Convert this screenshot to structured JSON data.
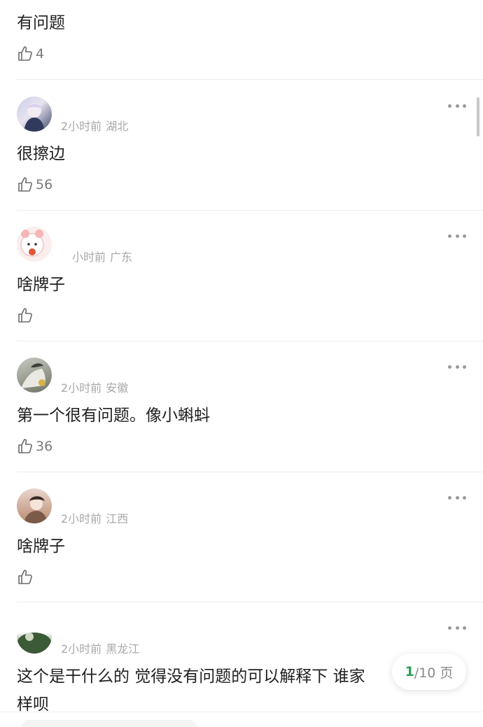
{
  "comments": [
    {
      "text": "有问题",
      "likes": "4"
    },
    {
      "time": "2小时前",
      "region": "湖北",
      "text": "很擦边",
      "likes": "56"
    },
    {
      "time": "小时前",
      "region": "广东",
      "text": "啥牌子",
      "likes": ""
    },
    {
      "time": "2小时前",
      "region": "安徽",
      "text": "第一个很有问题。像小蝌蚪",
      "likes": "36"
    },
    {
      "time": "2小时前",
      "region": "江西",
      "text": "啥牌子",
      "likes": ""
    },
    {
      "time": "2小时前",
      "region": "黑龙江",
      "text": "这个是干什么的 觉得没有问题的可以解释下 谁家样呗",
      "likes": ""
    }
  ],
  "pager": {
    "current": "1",
    "total": "/10 页"
  },
  "colors": {
    "accent": "#2e9e5a",
    "meta": "#a8a8a8",
    "divider": "#ececec"
  }
}
